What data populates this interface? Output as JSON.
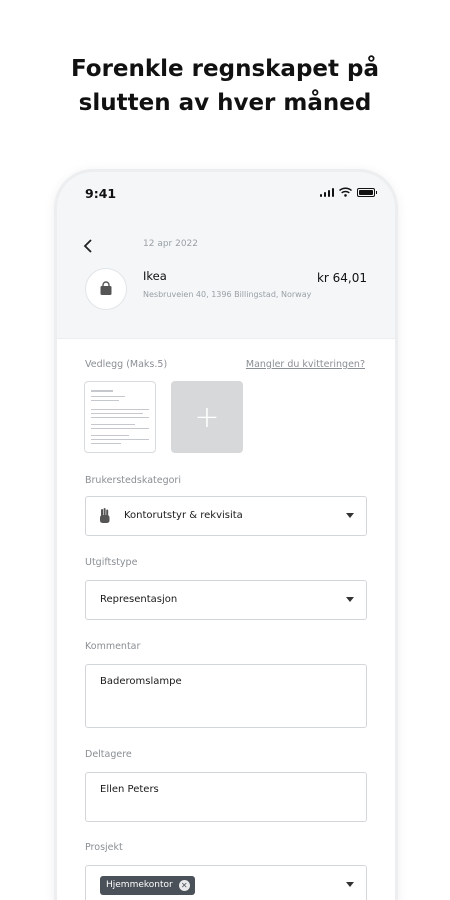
{
  "headline": {
    "line1": "Forenkle regnskapet på",
    "line2": "slutten av hver måned"
  },
  "status_bar": {
    "time": "9:41"
  },
  "expense": {
    "date": "12 apr 2022",
    "merchant": "Ikea",
    "address": "Nesbruveien 40, 1396 Billingstad, Norway",
    "amount": "kr 64,01",
    "merchant_icon": "shopping-bag-icon"
  },
  "attachments": {
    "label": "Vedlegg (Maks.5)",
    "missing_receipt_link": "Mangler du kvitteringen?",
    "add_icon": "+"
  },
  "merchant_category": {
    "label": "Brukerstedskategori",
    "value": "Kontorutstyr & rekvisita",
    "icon": "hand-icon"
  },
  "expense_type": {
    "label": "Utgiftstype",
    "value": "Representasjon"
  },
  "comment": {
    "label": "Kommentar",
    "value": "Baderomslampe"
  },
  "participants": {
    "label": "Deltagere",
    "value": "Ellen Peters"
  },
  "project": {
    "label": "Prosjekt",
    "chip": "Hjemmekontor",
    "chip_remove_glyph": "✕"
  },
  "colors": {
    "header_bg": "#f4f6f8",
    "chip_bg": "#4a5159",
    "add_tile_bg": "#d6d8da"
  }
}
